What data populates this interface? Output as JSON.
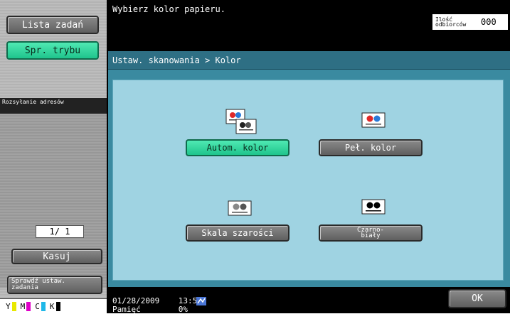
{
  "left_panel": {
    "job_list_label": "Lista zadań",
    "mode_check_label": "Spr. trybu",
    "address_book_label": "Rozsyłanie adresów",
    "page_counter": "1/ 1",
    "delete_label": "Kasuj",
    "check_job_label": "Sprawdź ustaw. zadania",
    "toner": [
      {
        "letter": "Y",
        "color": "#e8e800"
      },
      {
        "letter": "M",
        "color": "#e000c8"
      },
      {
        "letter": "C",
        "color": "#1fb8e8"
      },
      {
        "letter": "K",
        "color": "#000000"
      }
    ]
  },
  "header": {
    "message": "Wybierz kolor papieru.",
    "recipients_label": "Ilość odbiorców",
    "recipients_count": "000"
  },
  "main": {
    "breadcrumb": "Ustaw. skanowania > Kolor",
    "options": [
      {
        "label": "Autom. kolor",
        "selected": true,
        "icon": "auto-color-icon"
      },
      {
        "label": "Peł. kolor",
        "selected": false,
        "icon": "full-color-icon"
      },
      {
        "label": "Skala szarości",
        "selected": false,
        "icon": "grayscale-icon"
      },
      {
        "label": "Czarno-biały",
        "selected": false,
        "icon": "black-white-icon"
      }
    ]
  },
  "status": {
    "datetime": "01/28/2009    13:55",
    "memory": "Pamięć        0%"
  },
  "ok_label": "OK",
  "colors": {
    "selected_green": "#2fd59d",
    "panel_blue": "#9fd3e2",
    "breadcrumb_blue": "#2e6f84"
  }
}
